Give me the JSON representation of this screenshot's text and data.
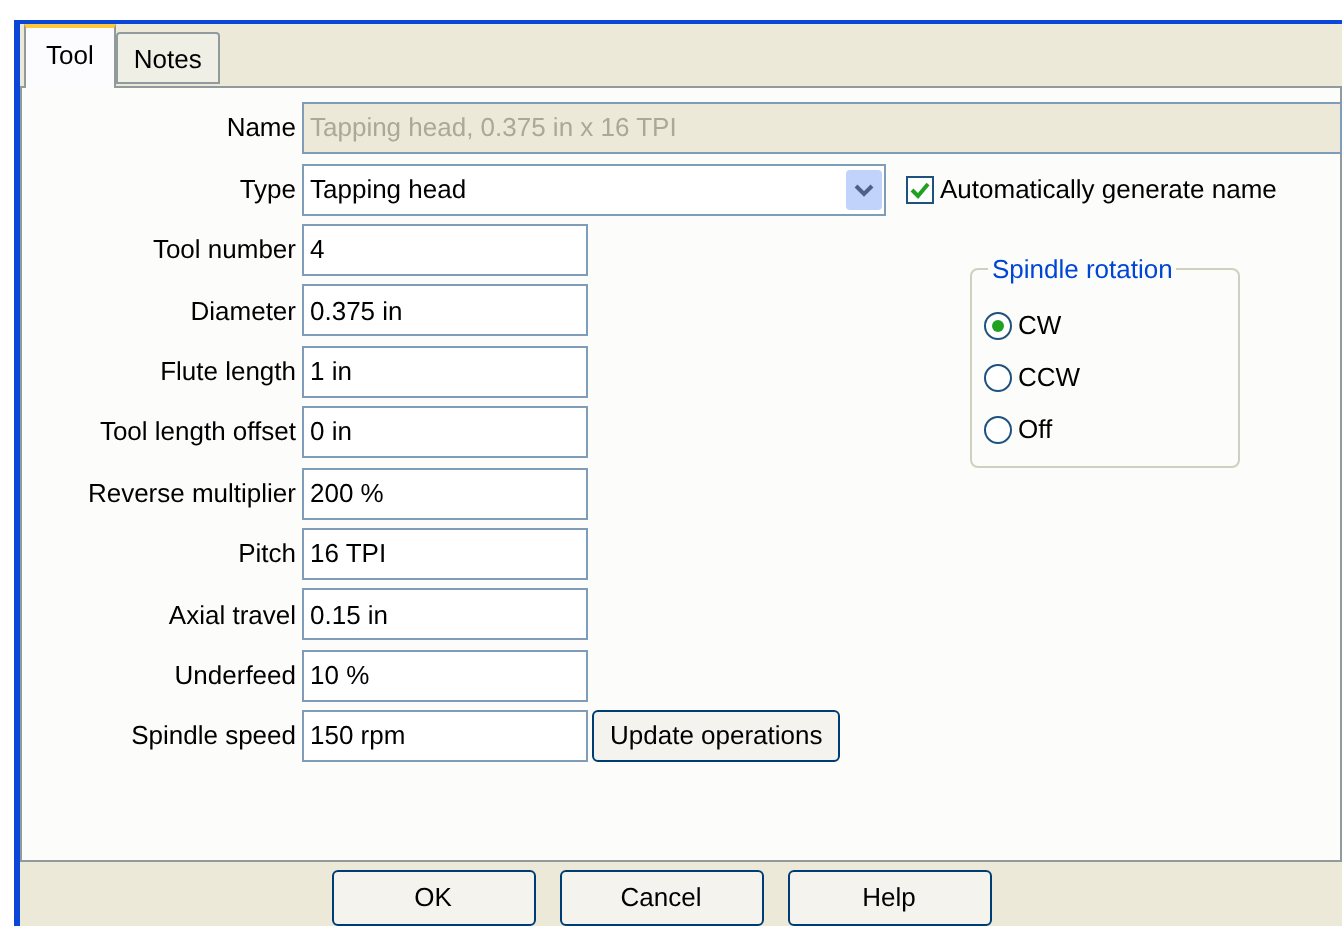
{
  "tabs": [
    {
      "label": "Tool",
      "selected": true
    },
    {
      "label": "Notes",
      "selected": false
    }
  ],
  "name_field": {
    "label": "Name",
    "value": "Tapping head, 0.375 in x 16 TPI",
    "disabled": true
  },
  "type_field": {
    "label": "Type",
    "value": "Tapping head"
  },
  "auto_name": {
    "label": "Automatically generate name",
    "checked": true
  },
  "fields": [
    {
      "label": "Tool number",
      "value": "4"
    },
    {
      "label": "Diameter",
      "value": "0.375 in"
    },
    {
      "label": "Flute length",
      "value": "1 in"
    },
    {
      "label": "Tool length offset",
      "value": "0 in"
    },
    {
      "label": "Reverse multiplier",
      "value": "200 %"
    },
    {
      "label": "Pitch",
      "value": "16 TPI"
    },
    {
      "label": "Axial travel",
      "value": "0.15 in"
    },
    {
      "label": "Underfeed",
      "value": "10 %"
    },
    {
      "label": "Spindle speed",
      "value": "150 rpm"
    }
  ],
  "update_button": "Update operations",
  "spindle_rotation": {
    "title": "Spindle rotation",
    "options": [
      {
        "label": "CW",
        "selected": true
      },
      {
        "label": "CCW",
        "selected": false
      },
      {
        "label": "Off",
        "selected": false
      }
    ]
  },
  "buttons": [
    "OK",
    "Cancel",
    "Help"
  ]
}
